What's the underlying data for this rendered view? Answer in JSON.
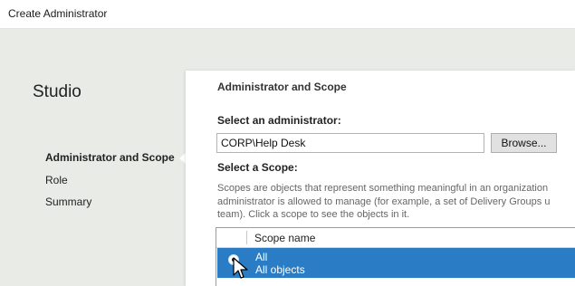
{
  "window": {
    "title": "Create Administrator"
  },
  "sidebar": {
    "brand": "Studio",
    "items": [
      {
        "label": "Administrator and Scope",
        "active": true
      },
      {
        "label": "Role",
        "active": false
      },
      {
        "label": "Summary",
        "active": false
      }
    ]
  },
  "main": {
    "heading": "Administrator and Scope",
    "admin_label": "Select an administrator:",
    "admin_value": "CORP\\Help Desk",
    "browse_label": "Browse...",
    "scope_label": "Select a Scope:",
    "scope_description": [
      "Scopes are objects that represent something meaningful in an organization",
      "administrator is allowed to manage (for example, a set of Delivery Groups u",
      "team). Click a scope to see the objects in it."
    ],
    "table": {
      "header": "Scope name",
      "rows": [
        {
          "name": "All",
          "description": "All objects",
          "selected": true
        }
      ]
    }
  },
  "colors": {
    "sidebar_bg": "#e9ebe7",
    "selection": "#2a7cc5"
  },
  "icons": {
    "radio": "radio-selected-icon",
    "cursor": "mouse-pointer-icon"
  }
}
